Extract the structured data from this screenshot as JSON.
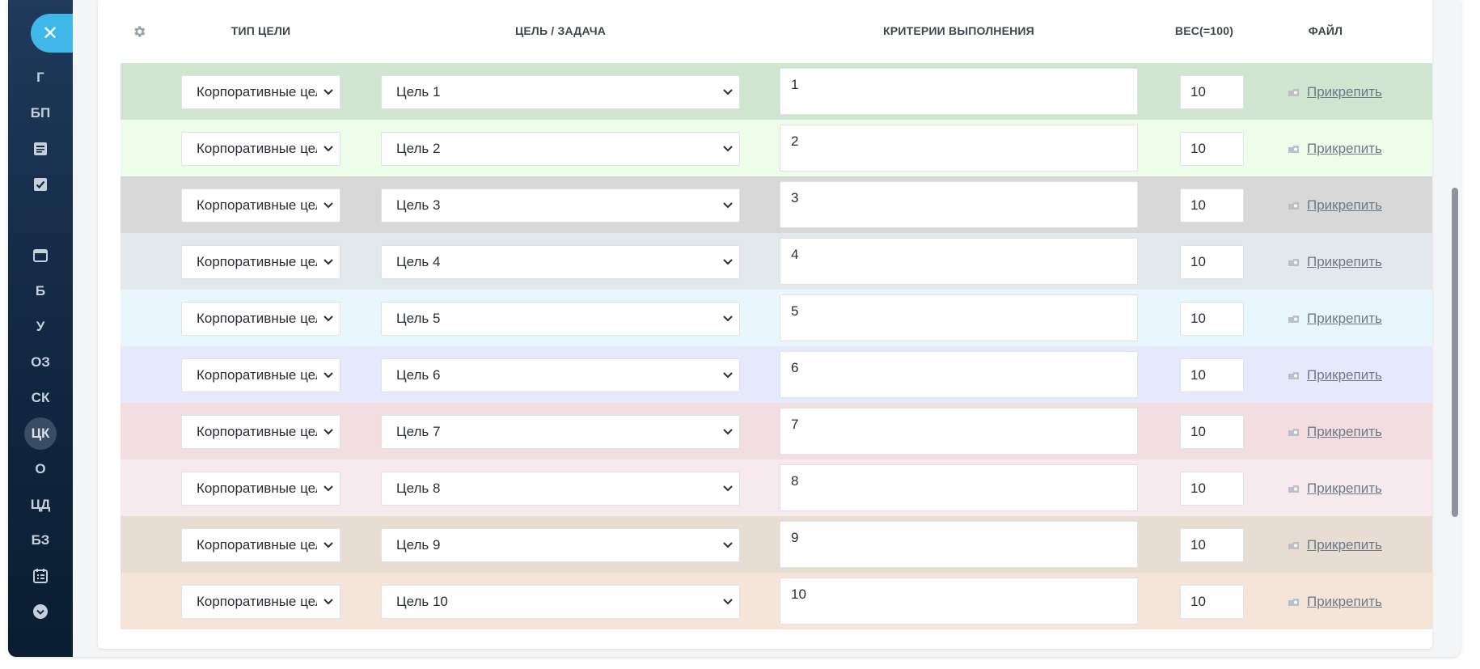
{
  "sidebar": {
    "close_icon": "close-icon",
    "items": [
      {
        "label": "Г"
      },
      {
        "label": "БП"
      },
      {
        "icon": "newspaper-icon"
      },
      {
        "icon": "checkbox-icon"
      },
      {
        "icon": "window-icon"
      },
      {
        "label": "Б"
      },
      {
        "label": "У"
      },
      {
        "label": "ОЗ"
      },
      {
        "label": "СК"
      },
      {
        "label": "ЦК",
        "active": true
      },
      {
        "label": "О"
      },
      {
        "label": "ЦД"
      },
      {
        "label": "БЗ"
      },
      {
        "icon": "calendar-list-icon"
      },
      {
        "icon": "chevron-down-circle-icon"
      }
    ]
  },
  "table": {
    "settings_icon": "gear-icon",
    "headers": {
      "type": "ТИП ЦЕЛИ",
      "goal": "ЦЕЛЬ / ЗАДАЧА",
      "criteria": "КРИТЕРИИ ВЫПОЛНЕНИЯ",
      "weight": "ВЕС(=100)",
      "file": "ФАЙЛ"
    },
    "rows": [
      {
        "type": "Корпоративные цели",
        "goal": "Цель 1",
        "criteria": "1",
        "weight": "10",
        "file": "Прикрепить",
        "color": "#cfe5cf"
      },
      {
        "type": "Корпоративные цели",
        "goal": "Цель 2",
        "criteria": "2",
        "weight": "10",
        "file": "Прикрепить",
        "color": "#eefde9"
      },
      {
        "type": "Корпоративные цели",
        "goal": "Цель 3",
        "criteria": "3",
        "weight": "10",
        "file": "Прикрепить",
        "color": "#d8d8d8"
      },
      {
        "type": "Корпоративные цели",
        "goal": "Цель 4",
        "criteria": "4",
        "weight": "10",
        "file": "Прикрепить",
        "color": "#e2e9ec"
      },
      {
        "type": "Корпоративные цели",
        "goal": "Цель 5",
        "criteria": "5",
        "weight": "10",
        "file": "Прикрепить",
        "color": "#e8f6fd"
      },
      {
        "type": "Корпоративные цели",
        "goal": "Цель 6",
        "criteria": "6",
        "weight": "10",
        "file": "Прикрепить",
        "color": "#e4eafb"
      },
      {
        "type": "Корпоративные цели",
        "goal": "Цель 7",
        "criteria": "7",
        "weight": "10",
        "file": "Прикрепить",
        "color": "#f2dde0"
      },
      {
        "type": "Корпоративные цели",
        "goal": "Цель 8",
        "criteria": "8",
        "weight": "10",
        "file": "Прикрепить",
        "color": "#f6eaee"
      },
      {
        "type": "Корпоративные цели",
        "goal": "Цель 9",
        "criteria": "9",
        "weight": "10",
        "file": "Прикрепить",
        "color": "#e8ddd3"
      },
      {
        "type": "Корпоративные цели",
        "goal": "Цель 10",
        "criteria": "10",
        "weight": "10",
        "file": "Прикрепить",
        "color": "#f5e5d8"
      }
    ]
  },
  "colors": {
    "accent": "#3fb7e8",
    "sidebar_bg": "#132a44",
    "header_text": "#3d4651",
    "link": "#6e7a86"
  }
}
